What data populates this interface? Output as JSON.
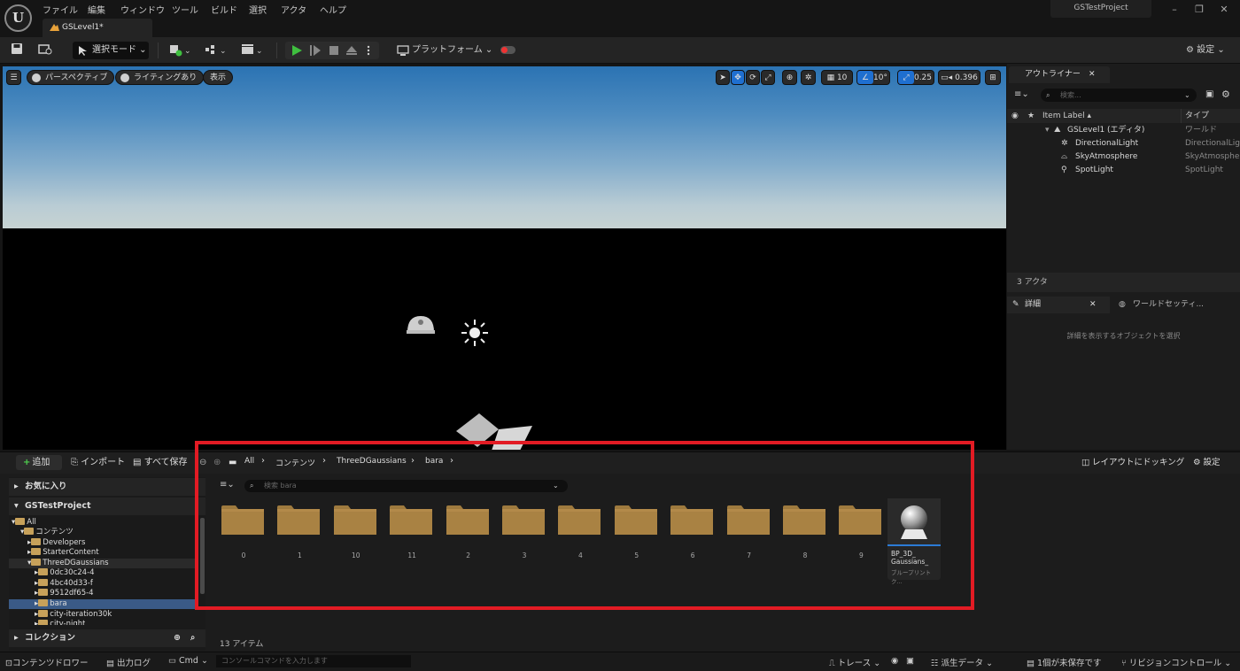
{
  "app": {
    "menus": [
      "ファイル",
      "編集",
      "ウィンドウ",
      "ツール",
      "ビルド",
      "選択",
      "アクタ",
      "ヘルプ"
    ],
    "doc_tab": "GSLevel1*",
    "project_name": "GSTestProject"
  },
  "toolbar": {
    "mode_label": "選択モード",
    "platform_label": "プラットフォーム",
    "settings_label": "設定"
  },
  "viewport": {
    "perspective_label": "パースペクティブ",
    "lighting_label": "ライティングあり",
    "show_label": "表示",
    "grid_value": "10",
    "angle_value": "10°",
    "scale_value": "0.25",
    "camera_speed": "0.396"
  },
  "outliner": {
    "tab_label": "アウトライナー",
    "search_placeholder": "検索...",
    "col_label": "Item Label ▴",
    "col_type": "タイプ",
    "rows": [
      {
        "label": "GSLevel1 (エディタ)",
        "type": "ワールド"
      },
      {
        "label": "DirectionalLight",
        "type": "DirectionalLig"
      },
      {
        "label": "SkyAtmosphere",
        "type": "SkyAtmosphe"
      },
      {
        "label": "SpotLight",
        "type": "SpotLight"
      }
    ],
    "count": "3 アクタ"
  },
  "details": {
    "tab_label": "詳細",
    "world_settings_tab": "ワールドセッティ...",
    "empty_message": "詳細を表示するオブジェクトを選択"
  },
  "content_browser": {
    "add_label": "追加",
    "import_label": "インポート",
    "save_all_label": "すべて保存",
    "breadcrumbs": [
      "All",
      "コンテンツ",
      "ThreeDGaussians",
      "bara"
    ],
    "dock_label": "レイアウトにドッキング",
    "settings_label": "設定",
    "favorites_label": "お気に入り",
    "project_label": "GSTestProject",
    "collections_label": "コレクション",
    "search_placeholder": "検索 bara",
    "tree": [
      "All",
      "コンテンツ",
      "Developers",
      "StarterContent",
      "ThreeDGaussians",
      "0dc30c24-4",
      "4bc40d33-f",
      "9512df65-4",
      "bara",
      "city-iteration30k",
      "city-night"
    ],
    "folders": [
      "0",
      "1",
      "10",
      "11",
      "2",
      "3",
      "4",
      "5",
      "6",
      "7",
      "8",
      "9"
    ],
    "blueprint": {
      "name": "BP_3D_ Gaussians_",
      "type": "ブループリント ク..."
    },
    "item_count": "13 アイテム"
  },
  "statusbar": {
    "content_drawer": "コンテンツドロワー",
    "output_log": "出力ログ",
    "cmd": "Cmd",
    "console_placeholder": "コンソールコマンドを入力します",
    "trace": "トレース",
    "derived_data": "派生データ",
    "unsaved": "1個が未保存です",
    "revision_control": "リビジョンコントロール"
  },
  "colors": {
    "highlight": "#e21b24",
    "accent_blue": "#1f6fd0",
    "play_green": "#3fbf3f",
    "folder": "#c7a15a"
  }
}
